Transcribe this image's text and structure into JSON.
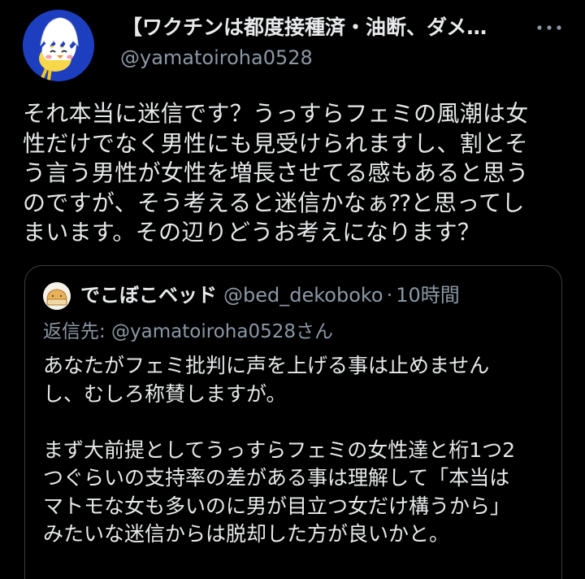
{
  "author": {
    "display_name": "【ワクチンは都度接種済・油断、ダメ…",
    "handle": "@yamatoiroha0528",
    "avatar_icon": "egg-chick-avatar",
    "more_icon": "more-icon"
  },
  "tweet": {
    "lines": [
      "それ本当に迷信です？うっすらフェミの風潮は女",
      "性だけでなく男性にも見受けられますし、割とそ",
      "う言う男性が女性を増長させてる感もあると思う",
      "のですが、そう考えると迷信かなぁ⁇と思ってし",
      "まいます。その辺りどうお考えになります？"
    ]
  },
  "quote": {
    "avatar_icon": "bread-bed-avatar",
    "display_name": "でこぼこベッド",
    "handle": "@bed_dekoboko",
    "separator": "·",
    "time": "10時間",
    "reply_to": "返信先: @yamatoiroha0528さん",
    "lines": [
      "あなたがフェミ批判に声を上げる事は止めません",
      "し、むしろ称賛しますが。",
      "",
      "まず大前提としてうっすらフェミの女性達と桁1つ2",
      "つぐらいの支持率の差がある事は理解して「本当は",
      "マトモな女も多いのに男が目立つ女だけ構うから」",
      "みたいな迷信からは脱却した方が良いかと。"
    ]
  },
  "colors": {
    "background": "#000000",
    "text_primary": "#e7e9ea",
    "text_secondary": "#8b98a5",
    "border": "#3a3f44",
    "avatar_bg": "#1d3fbf"
  }
}
